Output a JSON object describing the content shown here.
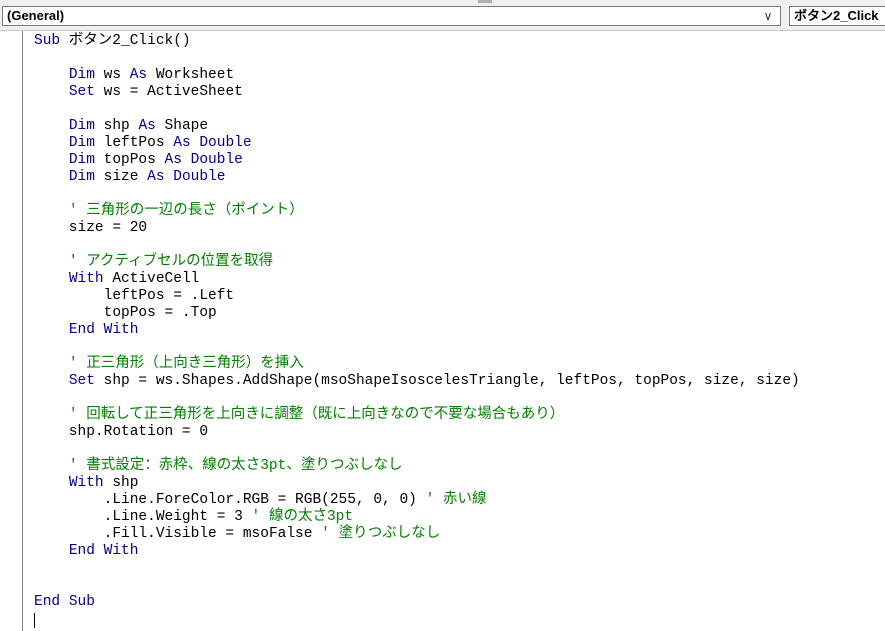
{
  "toolbar": {
    "object_combo": "(General)",
    "object_combo_arrow": "∨",
    "procedure_combo": "ボタン2_Click"
  },
  "code": {
    "lines": [
      [
        {
          "t": "kw",
          "v": "Sub"
        },
        {
          "t": "tx",
          "v": " ボタン2_Click()"
        }
      ],
      [],
      [
        {
          "t": "tx",
          "v": "    "
        },
        {
          "t": "kw",
          "v": "Dim"
        },
        {
          "t": "tx",
          "v": " ws "
        },
        {
          "t": "kw",
          "v": "As"
        },
        {
          "t": "tx",
          "v": " Worksheet"
        }
      ],
      [
        {
          "t": "tx",
          "v": "    "
        },
        {
          "t": "kw",
          "v": "Set"
        },
        {
          "t": "tx",
          "v": " ws = ActiveSheet"
        }
      ],
      [],
      [
        {
          "t": "tx",
          "v": "    "
        },
        {
          "t": "kw",
          "v": "Dim"
        },
        {
          "t": "tx",
          "v": " shp "
        },
        {
          "t": "kw",
          "v": "As"
        },
        {
          "t": "tx",
          "v": " Shape"
        }
      ],
      [
        {
          "t": "tx",
          "v": "    "
        },
        {
          "t": "kw",
          "v": "Dim"
        },
        {
          "t": "tx",
          "v": " leftPos "
        },
        {
          "t": "kw",
          "v": "As"
        },
        {
          "t": "tx",
          "v": " "
        },
        {
          "t": "kw",
          "v": "Double"
        }
      ],
      [
        {
          "t": "tx",
          "v": "    "
        },
        {
          "t": "kw",
          "v": "Dim"
        },
        {
          "t": "tx",
          "v": " topPos "
        },
        {
          "t": "kw",
          "v": "As"
        },
        {
          "t": "tx",
          "v": " "
        },
        {
          "t": "kw",
          "v": "Double"
        }
      ],
      [
        {
          "t": "tx",
          "v": "    "
        },
        {
          "t": "kw",
          "v": "Dim"
        },
        {
          "t": "tx",
          "v": " size "
        },
        {
          "t": "kw",
          "v": "As"
        },
        {
          "t": "tx",
          "v": " "
        },
        {
          "t": "kw",
          "v": "Double"
        }
      ],
      [],
      [
        {
          "t": "tx",
          "v": "    "
        },
        {
          "t": "cm",
          "v": "' 三角形の一辺の長さ（ポイント）"
        }
      ],
      [
        {
          "t": "tx",
          "v": "    size = 20"
        }
      ],
      [],
      [
        {
          "t": "tx",
          "v": "    "
        },
        {
          "t": "cm",
          "v": "' アクティブセルの位置を取得"
        }
      ],
      [
        {
          "t": "tx",
          "v": "    "
        },
        {
          "t": "kw",
          "v": "With"
        },
        {
          "t": "tx",
          "v": " ActiveCell"
        }
      ],
      [
        {
          "t": "tx",
          "v": "        leftPos = .Left"
        }
      ],
      [
        {
          "t": "tx",
          "v": "        topPos = .Top"
        }
      ],
      [
        {
          "t": "tx",
          "v": "    "
        },
        {
          "t": "kw",
          "v": "End"
        },
        {
          "t": "tx",
          "v": " "
        },
        {
          "t": "kw",
          "v": "With"
        }
      ],
      [],
      [
        {
          "t": "tx",
          "v": "    "
        },
        {
          "t": "cm",
          "v": "' 正三角形（上向き三角形）を挿入"
        }
      ],
      [
        {
          "t": "tx",
          "v": "    "
        },
        {
          "t": "kw",
          "v": "Set"
        },
        {
          "t": "tx",
          "v": " shp = ws.Shapes.AddShape(msoShapeIsoscelesTriangle, leftPos, topPos, size, size)"
        }
      ],
      [],
      [
        {
          "t": "tx",
          "v": "    "
        },
        {
          "t": "cm",
          "v": "' 回転して正三角形を上向きに調整（既に上向きなので不要な場合もあり）"
        }
      ],
      [
        {
          "t": "tx",
          "v": "    shp.Rotation = 0"
        }
      ],
      [],
      [
        {
          "t": "tx",
          "v": "    "
        },
        {
          "t": "cm",
          "v": "' 書式設定：赤枠、線の太さ3pt、塗りつぶしなし"
        }
      ],
      [
        {
          "t": "tx",
          "v": "    "
        },
        {
          "t": "kw",
          "v": "With"
        },
        {
          "t": "tx",
          "v": " shp"
        }
      ],
      [
        {
          "t": "tx",
          "v": "        .Line.ForeColor.RGB = RGB(255, 0, 0) "
        },
        {
          "t": "cm",
          "v": "' 赤い線"
        }
      ],
      [
        {
          "t": "tx",
          "v": "        .Line.Weight = 3 "
        },
        {
          "t": "cm",
          "v": "' 線の太さ3pt"
        }
      ],
      [
        {
          "t": "tx",
          "v": "        .Fill.Visible = msoFalse "
        },
        {
          "t": "cm",
          "v": "' 塗りつぶしなし"
        }
      ],
      [
        {
          "t": "tx",
          "v": "    "
        },
        {
          "t": "kw",
          "v": "End"
        },
        {
          "t": "tx",
          "v": " "
        },
        {
          "t": "kw",
          "v": "With"
        }
      ],
      [],
      [],
      [
        {
          "t": "kw",
          "v": "End"
        },
        {
          "t": "tx",
          "v": " "
        },
        {
          "t": "kw",
          "v": "Sub"
        }
      ]
    ]
  },
  "colors": {
    "keyword": "#00008b",
    "comment": "#008000",
    "text": "#000000"
  }
}
